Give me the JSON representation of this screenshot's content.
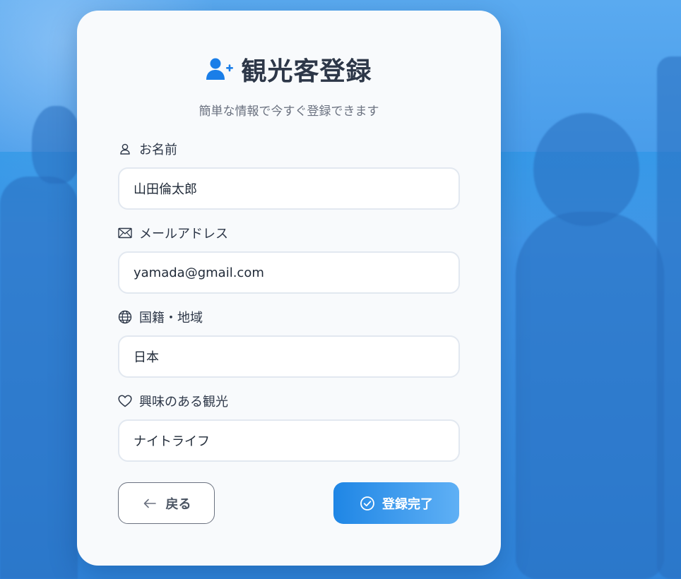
{
  "header": {
    "title": "観光客登録",
    "subtitle": "簡単な情報で今すぐ登録できます",
    "icon": "user-plus-icon"
  },
  "form": {
    "fields": [
      {
        "label": "お名前",
        "icon": "user-icon",
        "value": "山田倫太郎"
      },
      {
        "label": "メールアドレス",
        "icon": "envelope-icon",
        "value": "yamada@gmail.com"
      },
      {
        "label": "国籍・地域",
        "icon": "globe-icon",
        "value": "日本"
      },
      {
        "label": "興味のある観光",
        "icon": "heart-icon",
        "value": "ナイトライフ"
      }
    ]
  },
  "actions": {
    "back_label": "戻る",
    "submit_label": "登録完了"
  },
  "colors": {
    "accent": "#1f86e5",
    "accent_light": "#5fb0f5",
    "card_bg": "#f8fafc",
    "page_bg": "#3d93e6"
  }
}
